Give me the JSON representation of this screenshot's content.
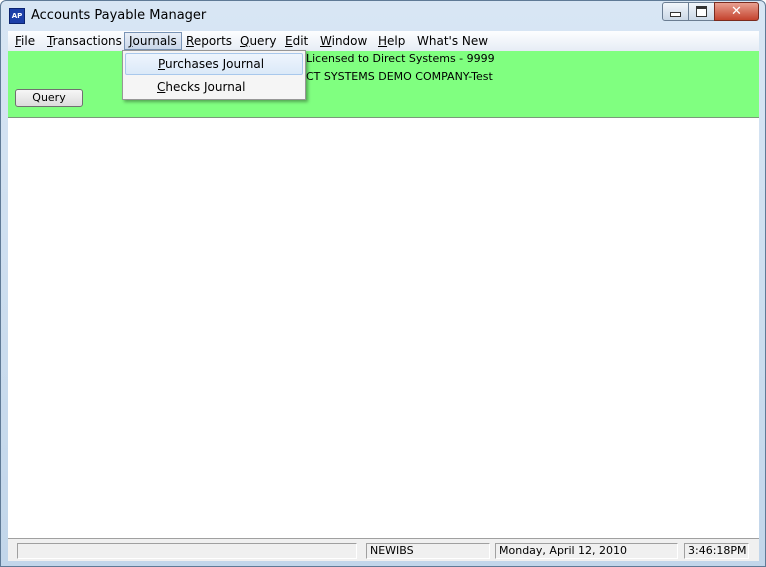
{
  "window": {
    "title": "Accounts Payable Manager",
    "icon_text": "AP",
    "icon_name": "accounts-payable-app-icon"
  },
  "menu": {
    "items": [
      {
        "label": "File",
        "hotkey_index": 0
      },
      {
        "label": "Transactions",
        "hotkey_index": 0
      },
      {
        "label": "Journals",
        "hotkey_index": 0,
        "active": true
      },
      {
        "label": "Reports",
        "hotkey_index": 0
      },
      {
        "label": "Query",
        "hotkey_index": 0
      },
      {
        "label": "Edit",
        "hotkey_index": 0
      },
      {
        "label": "Window",
        "hotkey_index": 0
      },
      {
        "label": "Help",
        "hotkey_index": 0
      },
      {
        "label": "What's New",
        "hotkey_index": -1
      }
    ]
  },
  "journals_menu": {
    "items": [
      {
        "label": "Purchases Journal",
        "hotkey_index": 0,
        "highlighted": true
      },
      {
        "label": "Checks Journal",
        "hotkey_index": 0,
        "highlighted": false
      }
    ]
  },
  "banner": {
    "license_text": "Licensed to Direct Systems - 9999",
    "company_text": "CT SYSTEMS DEMO COMPANY-Test",
    "query_button": "Query",
    "background_color": "#80ff80"
  },
  "status": {
    "panel1": "",
    "panel2": "NEWIBS",
    "panel3": "Monday, April 12, 2010",
    "panel4": "3:46:18PM"
  }
}
